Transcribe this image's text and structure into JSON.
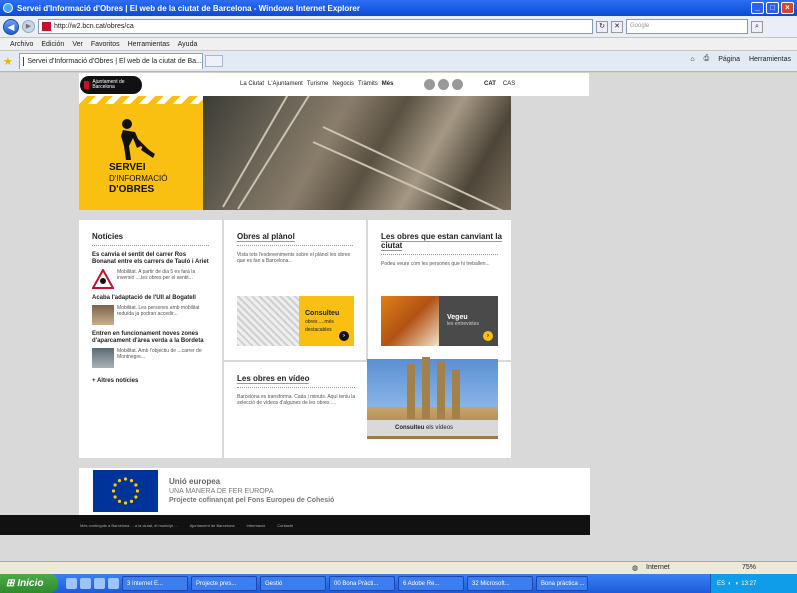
{
  "window": {
    "title": "Servei d'Informació d'Obres | El web de la ciutat de Barcelona - Windows Internet Explorer"
  },
  "browser": {
    "url": "http://w2.bcn.cat/obres/ca",
    "search_placeholder": "Google",
    "menu": [
      "Archivo",
      "Edición",
      "Ver",
      "Favoritos",
      "Herramientas",
      "Ayuda"
    ],
    "tab_title": "Servei d'Informació d'Obres | El web de la ciutat de Ba...",
    "tools": {
      "page": "Página",
      "tools": "Herramientas"
    }
  },
  "site": {
    "logo_text": "Ajuntament de Barcelona",
    "nav": [
      "La Ciutat",
      "L'Ajuntament",
      "Turisme",
      "Negocis",
      "Tràmits",
      "Més"
    ],
    "languages": [
      "CAT",
      "CAS"
    ],
    "hero": {
      "line1": "SERVEI",
      "line2": "D'INFORMACIÓ",
      "line3": "D'OBRES"
    },
    "news": {
      "title": "Notícies",
      "items": [
        {
          "title": "Es canvia el sentit del carrer Ros Bonanat entre els carrers de Tauló i Ariet",
          "text": "Mobilitat. A partir de dia 5 es farà la inversió ....les obres per el sentit..."
        },
        {
          "title": "Acaba l'adaptació de l'Ull al Bogatell",
          "text": "Mobilitat. Les persones amb mobilitat reduïda ja podran accedir..."
        },
        {
          "title": "Entren en funcionament noves zones d'aparcament d'àrea verda a la Bordeta",
          "text": "Mobilitat. Amb l'objectiu de ...carrer de Montnegre..."
        }
      ],
      "more": "+ Altres notícies"
    },
    "plan": {
      "title": "Obres al plànol",
      "text": "Vista tots l'esdeveniments sobre el plànol les obres que es fan a Barcelona...",
      "cta1": "Consulteu",
      "cta2": "obres ....més destacables"
    },
    "people": {
      "title": "Les obres que estan canviant la ciutat",
      "text": "Podeu veure com les persones que hi treballen...",
      "cta1": "Vegeu",
      "cta2": "les entrevistes"
    },
    "video": {
      "title": "Les obres en vídeo",
      "text": "Barcelona es transforma. Cada i minuts. Aquí teniu la selecció de vídeos d'algunes de les obres ....",
      "cta1": "Consulteu",
      "cta2": "els vídeos"
    },
    "eu": {
      "line1": "Unió europea",
      "line2": "UNA MANERA DE FER EUROPA",
      "line3": "Projecte cofinançat pel Fons Europeu de Cohesió"
    },
    "footer": [
      "Més continguts a Barcelona ... a la ciutat, el municipi ...",
      "Ajuntament de Barcelona",
      "Informació",
      "Contacte"
    ]
  },
  "status": {
    "zone": "Internet",
    "zoom": "75%"
  },
  "taskbar": {
    "start": "Inicio",
    "tasks": [
      "3 Internet E...",
      "Projecte pres...",
      "Gestió",
      "00 Bona Pràcti...",
      "6 Adobe Re...",
      "32 Microsoft...",
      "Bona pràctica ..."
    ],
    "lang": "ES",
    "time": "13:27"
  }
}
